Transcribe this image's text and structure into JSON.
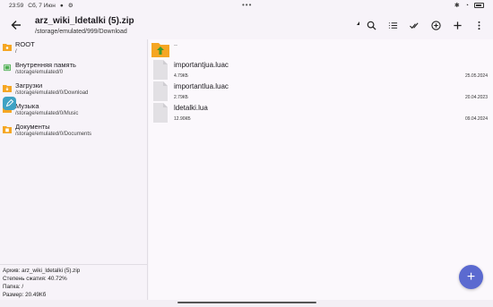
{
  "status_bar": {
    "time": "23:59",
    "date": "Сб, 7 Июн",
    "center_dots": "•••"
  },
  "app_bar": {
    "title": "arz_wiki_ldetalki (5).zip",
    "subtitle": "/storage/emulated/999/Download",
    "actions": [
      "search-icon",
      "list-view-icon",
      "select-all-icon",
      "add-circle-icon",
      "plus-icon",
      "more-vert-icon"
    ]
  },
  "places": [
    {
      "name": "ROOT",
      "path": "/",
      "icon": "folder-icon",
      "color": "#f5a623"
    },
    {
      "name": "Внутренняя память",
      "path": "/storage/emulated/0",
      "icon": "phone-storage-icon",
      "color": "#4caf50"
    },
    {
      "name": "Загрузки",
      "path": "/storage/emulated/0/Download",
      "icon": "download-folder-icon",
      "color": "#f5a623"
    },
    {
      "name": "Музыка",
      "path": "/storage/emulated/0/Music",
      "icon": "music-folder-icon",
      "color": "#f5a623"
    },
    {
      "name": "Документы",
      "path": "/storage/emulated/0/Documents",
      "icon": "documents-folder-icon",
      "color": "#f5a623"
    }
  ],
  "archive_info": {
    "archive": "Архив: arz_wiki_ldetalki (5).zip",
    "compression": "Степень сжатия: 40.72%",
    "folder": "Папка: /",
    "size": "Размер: 20.49Кб"
  },
  "up_row": {
    "label": ".."
  },
  "files": [
    {
      "name": "importantjua.luac",
      "size": "4.79КБ",
      "date": "25.05.2024"
    },
    {
      "name": "importantlua.luac",
      "size": "2.79КБ",
      "date": "20.04.2023"
    },
    {
      "name": "ldetalki.lua",
      "size": "12.90КБ",
      "date": "09.04.2024"
    }
  ],
  "fab": {
    "label": "+"
  },
  "colors": {
    "accent": "#5b6ad0",
    "folder": "#f5a623",
    "floating_edit": "#3fa2c4"
  }
}
